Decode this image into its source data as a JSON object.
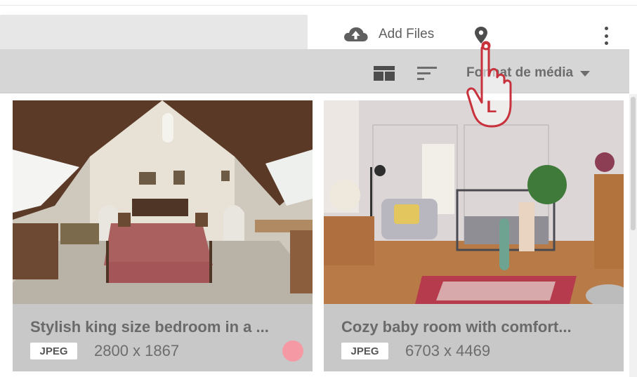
{
  "toolbar": {
    "add_files_label": "Add Files",
    "search_placeholder": ""
  },
  "filter_bar": {
    "format_label": "Format de média"
  },
  "cards": [
    {
      "title": "Stylish king size bedroom in a ...",
      "format": "JPEG",
      "dimensions": "2800 x 1867",
      "label_color": "#f59aa5"
    },
    {
      "title": "Cozy baby room with comfort...",
      "format": "JPEG",
      "dimensions": "6703 x 4469"
    }
  ],
  "cursor": {
    "letter": "L"
  },
  "icons": {
    "upload": "cloud-upload-icon",
    "location": "map-pin-icon",
    "more": "more-vertical-icon",
    "view": "grid-view-icon",
    "sort": "sort-icon",
    "dropdown": "chevron-down-icon"
  },
  "colors": {
    "toolbar_bg": "#ffffff",
    "filterbar_bg": "#d6d6d6",
    "card_bg": "#c8c8c8",
    "label_pink": "#f59aa5"
  }
}
